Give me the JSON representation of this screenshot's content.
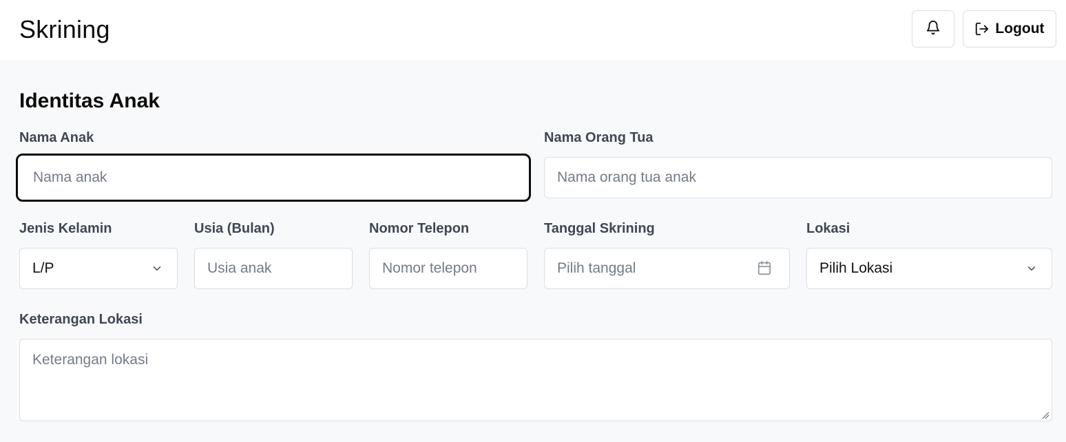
{
  "header": {
    "title": "Skrining",
    "notifications_icon": "bell-icon",
    "logout_icon": "logout-icon",
    "logout_label": "Logout"
  },
  "form": {
    "section_title": "Identitas Anak",
    "nama_anak": {
      "label": "Nama Anak",
      "placeholder": "Nama anak",
      "value": ""
    },
    "nama_orang_tua": {
      "label": "Nama Orang Tua",
      "placeholder": "Nama orang tua anak",
      "value": ""
    },
    "jenis_kelamin": {
      "label": "Jenis Kelamin",
      "selected": "L/P",
      "icon": "chevron-down-icon"
    },
    "usia": {
      "label": "Usia (Bulan)",
      "placeholder": "Usia anak",
      "value": ""
    },
    "nomor_telepon": {
      "label": "Nomor Telepon",
      "placeholder": "Nomor telepon",
      "value": ""
    },
    "tanggal_skrining": {
      "label": "Tanggal Skrining",
      "placeholder": "Pilih tanggal",
      "value": "",
      "icon": "calendar-icon"
    },
    "lokasi": {
      "label": "Lokasi",
      "selected": "Pilih Lokasi",
      "icon": "chevron-down-icon"
    },
    "keterangan_lokasi": {
      "label": "Keterangan Lokasi",
      "placeholder": "Keterangan lokasi",
      "value": ""
    }
  },
  "colors": {
    "background": "#f8f9fa",
    "surface": "#ffffff",
    "border": "#dadde2",
    "focus_border": "#0b0b0c",
    "label_text": "#3f4753",
    "placeholder_text": "#747b86"
  }
}
